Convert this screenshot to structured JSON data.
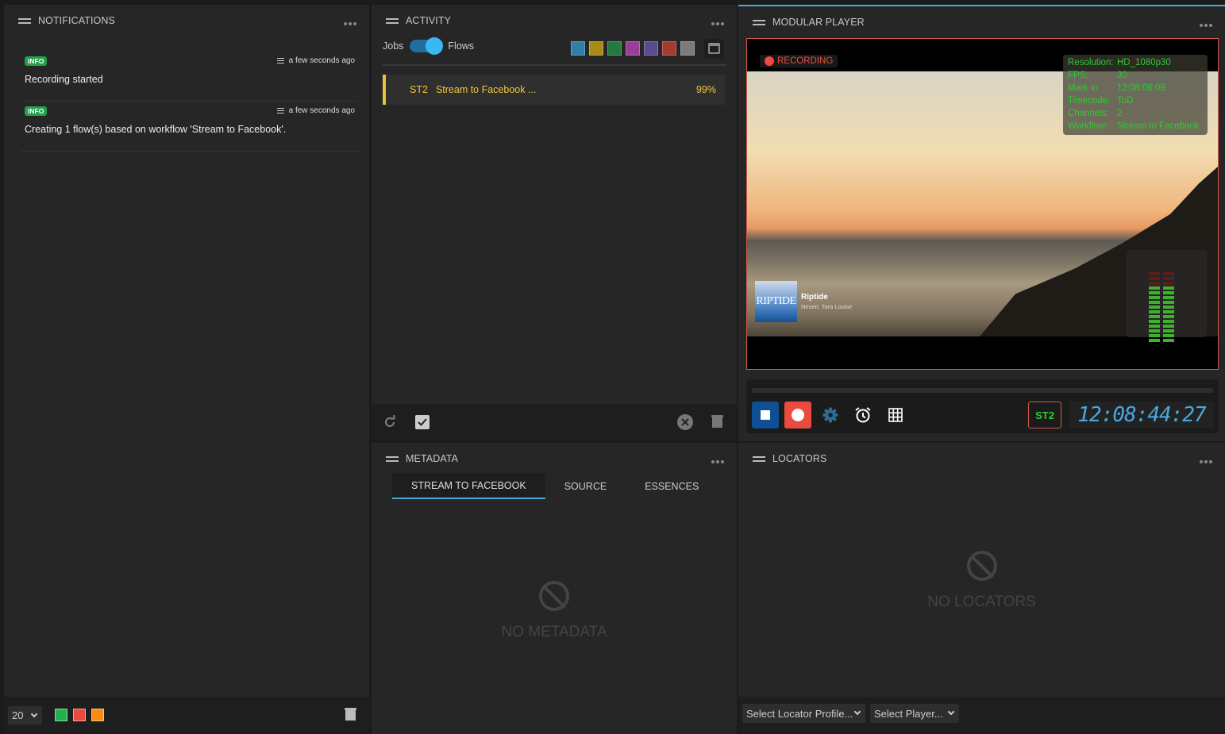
{
  "notifications": {
    "title": "NOTIFICATIONS",
    "items": [
      {
        "level": "INFO",
        "time": "a few seconds ago",
        "message": "Recording started"
      },
      {
        "level": "INFO",
        "time": "a few seconds ago",
        "message": "Creating 1 flow(s) based on workflow 'Stream to Facebook'."
      }
    ],
    "page_size": "20",
    "filter_colors": [
      "#22b14c",
      "#ec4a3e",
      "#f78b14"
    ]
  },
  "activity": {
    "title": "ACTIVITY",
    "toggle_left": "Jobs",
    "toggle_right": "Flows",
    "toggle_on": true,
    "filter_colors": [
      "#2f7fa8",
      "#a88b16",
      "#237a3f",
      "#9a3d98",
      "#5c4a8e",
      "#a63a30",
      "#7b7b7b"
    ],
    "flows": [
      {
        "code": "ST2",
        "name": "Stream to Facebook ...",
        "progress": "99%"
      }
    ]
  },
  "metadata": {
    "title": "METADATA",
    "tabs": [
      "STREAM TO FACEBOOK",
      "SOURCE",
      "ESSENCES"
    ],
    "active_tab": 0,
    "empty_text": "NO METADATA"
  },
  "player": {
    "title": "MODULAR PLAYER",
    "recording_label": "RECORDING",
    "info": [
      {
        "key": "Resolution:",
        "value": "HD_1080p30"
      },
      {
        "key": "FPS:",
        "value": "30"
      },
      {
        "key": "Mark in:",
        "value": "12:08:06:09"
      },
      {
        "key": "Timecode:",
        "value": "ToD"
      },
      {
        "key": "Channels:",
        "value": "2"
      },
      {
        "key": "Workflow:",
        "value": "Stream to Facebook"
      }
    ],
    "overlay_track": {
      "cover_text": "RIPTIDE",
      "title": "Riptide",
      "artist": "Nexeri, Tara Louise"
    },
    "audio_channels": 2,
    "audio_level_segments_lit": 12,
    "audio_level_segments_total": 15,
    "channel_badge": "ST2",
    "timecode": "12:08:44:27"
  },
  "locators": {
    "title": "LOCATORS",
    "empty_text": "NO LOCATORS",
    "profile_select": "Select Locator Profile...",
    "player_select": "Select Player..."
  }
}
